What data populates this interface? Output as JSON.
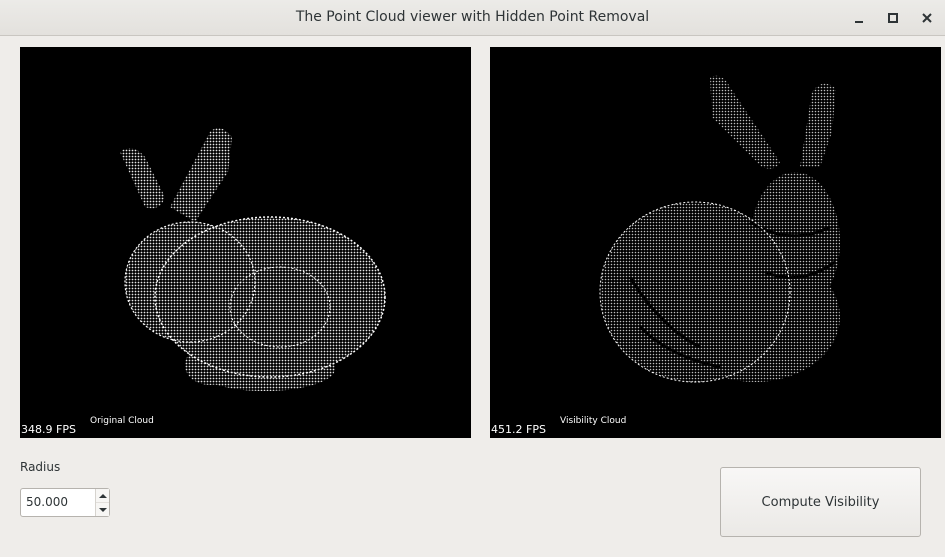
{
  "window": {
    "title": "The Point Cloud viewer with Hidden Point Removal"
  },
  "viewports": [
    {
      "label": "Original Cloud",
      "fps": "348.9 FPS"
    },
    {
      "label": "Visibility Cloud",
      "fps": "451.2 FPS"
    }
  ],
  "controls": {
    "radius_label": "Radius",
    "radius_value": "50.000",
    "compute_label": "Compute Visibility"
  },
  "icons": {
    "minimize": "minimize-icon",
    "maximize": "maximize-icon",
    "close": "close-icon",
    "spin_up": "chevron-up-icon",
    "spin_down": "chevron-down-icon"
  },
  "colors": {
    "viewport_bg": "#000000",
    "cloud": "#ffffff",
    "window_bg": "#efedea"
  }
}
